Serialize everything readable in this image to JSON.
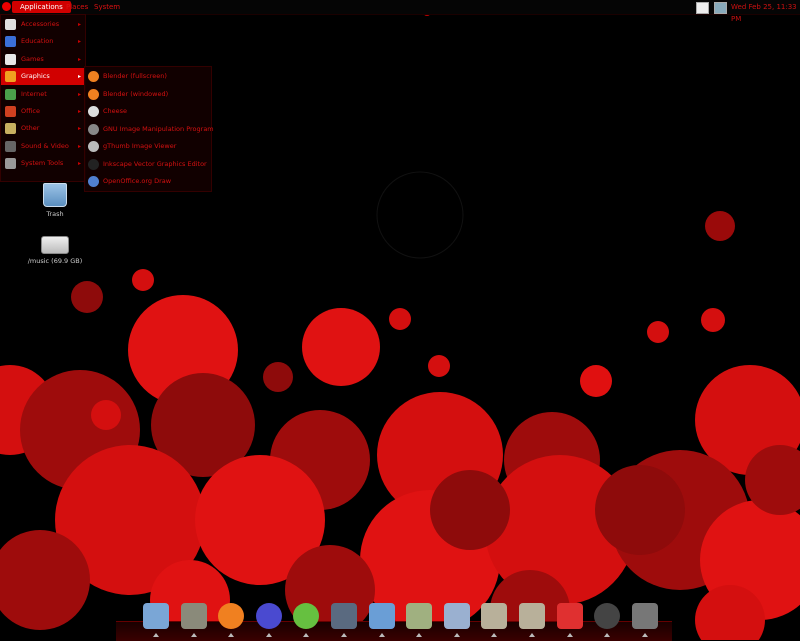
{
  "top_panel": {
    "applications_label": "Applications",
    "places_label": "Places",
    "system_label": "System",
    "clock_text": "Wed Feb 25, 11:33 PM",
    "tray_icons": [
      "network-icon",
      "volume-icon"
    ]
  },
  "apps_menu": {
    "items": [
      {
        "label": "Accessories",
        "icon": "accessories-icon",
        "color": "#e0e0e0"
      },
      {
        "label": "Education",
        "icon": "education-icon",
        "color": "#3a6fd8"
      },
      {
        "label": "Games",
        "icon": "games-icon",
        "color": "#e8e8e8"
      },
      {
        "label": "Graphics",
        "icon": "graphics-icon",
        "color": "#f0a020",
        "active": true
      },
      {
        "label": "Internet",
        "icon": "internet-icon",
        "color": "#4aa04a"
      },
      {
        "label": "Office",
        "icon": "office-icon",
        "color": "#d04020"
      },
      {
        "label": "Other",
        "icon": "other-icon",
        "color": "#c8b060"
      },
      {
        "label": "Sound & Video",
        "icon": "sound-video-icon",
        "color": "#666666"
      },
      {
        "label": "System Tools",
        "icon": "system-tools-icon",
        "color": "#999999"
      }
    ]
  },
  "graphics_submenu": {
    "items": [
      {
        "label": "Blender (fullscreen)",
        "icon": "blender-icon",
        "color": "#f08020"
      },
      {
        "label": "Blender (windowed)",
        "icon": "blender-icon",
        "color": "#f08020"
      },
      {
        "label": "Cheese",
        "icon": "cheese-icon",
        "color": "#dddddd"
      },
      {
        "label": "GNU Image Manipulation Program",
        "icon": "gimp-icon",
        "color": "#888888"
      },
      {
        "label": "gThumb Image Viewer",
        "icon": "gthumb-icon",
        "color": "#bbbbbb"
      },
      {
        "label": "Inkscape Vector Graphics Editor",
        "icon": "inkscape-icon",
        "color": "#222222"
      },
      {
        "label": "OpenOffice.org Draw",
        "icon": "ooo-draw-icon",
        "color": "#5080d0"
      }
    ]
  },
  "desktop": {
    "trash_label": "Trash",
    "drive_label": "/music (69.9 GB)"
  },
  "dock": {
    "icons": [
      {
        "name": "floppy-save-icon",
        "color": "#7aa6d6"
      },
      {
        "name": "gimp-icon",
        "color": "#8a8a7a"
      },
      {
        "name": "blender-icon",
        "color": "#f08020"
      },
      {
        "name": "inkscape-icon",
        "color": "#4a4ad0"
      },
      {
        "name": "play-icon",
        "color": "#66c040"
      },
      {
        "name": "shield-icon",
        "color": "#5a6a80"
      },
      {
        "name": "image-viewer-icon",
        "color": "#6a9ed6"
      },
      {
        "name": "calculator-icon",
        "color": "#a0b080"
      },
      {
        "name": "media-player-icon",
        "color": "#9ab0d0"
      },
      {
        "name": "folder-icon",
        "color": "#b8b09a"
      },
      {
        "name": "folder-icon-2",
        "color": "#b8b09a"
      },
      {
        "name": "gnome-foot-icon",
        "color": "#e03030"
      },
      {
        "name": "power-icon",
        "color": "#444444"
      },
      {
        "name": "terminal-icon",
        "color": "#777777"
      }
    ]
  },
  "colors": {
    "accent": "#d10000",
    "menu_text": "#d51010",
    "background": "#000000"
  }
}
